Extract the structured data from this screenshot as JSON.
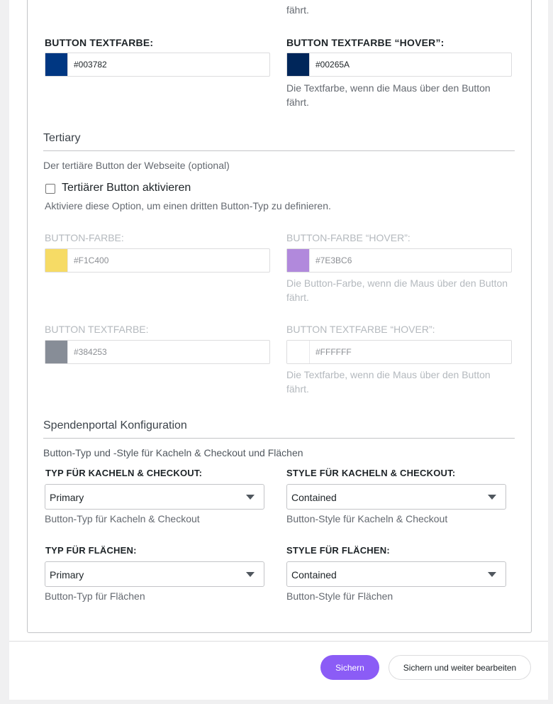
{
  "top_help_tail": "fährt.",
  "secondary": {
    "button_text_color": {
      "label": "BUTTON TEXTFARBE:",
      "value": "#003782",
      "swatch": "#003782"
    },
    "button_text_color_hover": {
      "label": "BUTTON TEXTFARBE “HOVER”:",
      "value": "#00265A",
      "swatch": "#00265A",
      "help_line1": "Die Textfarbe, wenn die Maus über den Button",
      "help_line2": "fährt."
    }
  },
  "tertiary": {
    "title": "Tertiary",
    "description": "Der tertiäre Button der Webseite (optional)",
    "checkbox_label": "Tertiärer Button aktivieren",
    "checkbox_help": "Aktiviere diese Option, um einen dritten Button-Typ zu definieren.",
    "button_color": {
      "label": "BUTTON-FARBE:",
      "value": "#F1C400",
      "swatch": "#F1C400"
    },
    "button_color_hover": {
      "label": "BUTTON-FARBE “HOVER”:",
      "value": "#7E3BC6",
      "swatch": "#7E3BC6",
      "help_line1": "Die Button-Farbe, wenn die Maus über den Button",
      "help_line2": "fährt."
    },
    "button_text_color": {
      "label": "BUTTON TEXTFARBE:",
      "value": "#384253",
      "swatch": "#384253"
    },
    "button_text_color_hover": {
      "label": "BUTTON TEXTFARBE “HOVER”:",
      "value": "#FFFFFF",
      "swatch": "#FFFFFF",
      "help_line1": "Die Textfarbe, wenn die Maus über den Button",
      "help_line2": "fährt."
    }
  },
  "portal": {
    "title": "Spendenportal Konfiguration",
    "description": "Button-Typ und -Style für Kacheln & Checkout und Flächen",
    "tile_type": {
      "label": "TYP FÜR KACHELN & CHECKOUT:",
      "value": "Primary",
      "help": "Button-Typ für Kacheln & Checkout"
    },
    "tile_style": {
      "label": "STYLE FÜR KACHELN & CHECKOUT:",
      "value": "Contained",
      "help": "Button-Style für Kacheln & Checkout"
    },
    "area_type": {
      "label": "TYP FÜR FLÄCHEN:",
      "value": "Primary",
      "help": "Button-Typ für Flächen"
    },
    "area_style": {
      "label": "STYLE FÜR FLÄCHEN:",
      "value": "Contained",
      "help": "Button-Style für Flächen"
    }
  },
  "footer": {
    "save_label": "Sichern",
    "save_continue_label": "Sichern und weiter bearbeiten"
  },
  "colors": {
    "accent": "#8b5cf6"
  }
}
